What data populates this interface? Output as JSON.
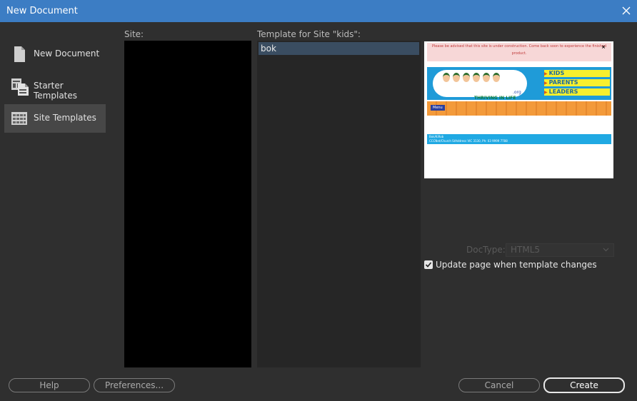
{
  "window": {
    "title": "New Document"
  },
  "sidebar": {
    "items": [
      {
        "label": "New Document",
        "icon": "new-document-icon",
        "selected": false
      },
      {
        "label": "Starter Templates",
        "icon": "starter-templates-icon",
        "selected": false
      },
      {
        "label": "Site Templates",
        "icon": "site-templates-icon",
        "selected": true
      }
    ]
  },
  "site_column": {
    "label": "Site:"
  },
  "template_column": {
    "label": "Template for Site \"kids\":",
    "items": [
      "bok"
    ]
  },
  "preview": {
    "notice": "Please be advised that this site is under construction. Come back soon to experience the finished product.",
    "close_glyph": "×",
    "slogan": "THRIVING IN LIFE",
    "org": ".org",
    "menu_items": [
      "KIDS",
      "PARENTS",
      "LEADERS"
    ],
    "menu_button": "Menu",
    "footer_line1": "Bok/KiRob",
    "footer_line2": "CCCNet/Church StAddress VIC 3130, Ph: 03 9999 7788"
  },
  "doctype": {
    "label": "DocType:",
    "value": "HTML5"
  },
  "update_checkbox": {
    "label": "Update page when template changes",
    "checked": true
  },
  "buttons": {
    "help": "Help",
    "preferences": "Preferences...",
    "cancel": "Cancel",
    "create": "Create"
  },
  "colors": {
    "titlebar": "#3c7dc4",
    "background": "#2f2f2f",
    "selected_nav": "#474747",
    "selected_item": "#3a4d61"
  }
}
